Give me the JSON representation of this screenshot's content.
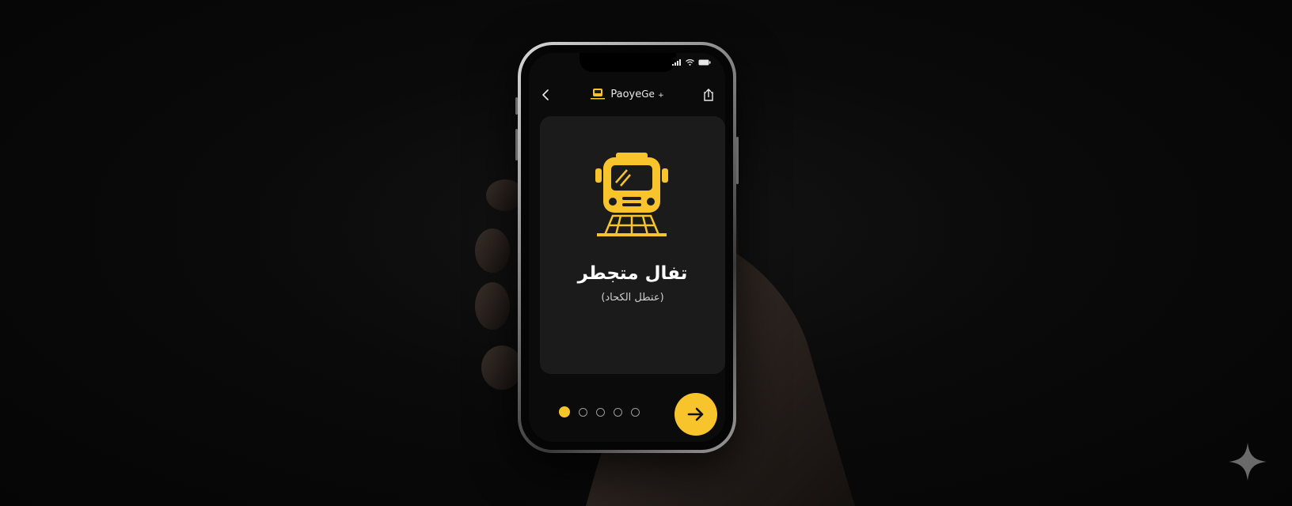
{
  "colors": {
    "accent": "#f7c42b",
    "screen_bg": "#0b0b0b",
    "card_bg": "#1b1b1b",
    "text_primary": "#ffffff",
    "text_secondary": "#cfcfcf"
  },
  "status_bar": {
    "icons": [
      "signal-icon",
      "wifi-icon",
      "battery-icon"
    ]
  },
  "header": {
    "back_icon": "chevron-left-icon",
    "logo_icon": "bus-logo-icon",
    "brand_name": "Paoye",
    "brand_name_2": "Ge",
    "brand_suffix": "+",
    "share_icon": "share-icon"
  },
  "card": {
    "illustration": "bus-icon",
    "title": "تفال متجطر",
    "subtitle": "(عتطل الكحاد)"
  },
  "pagination": {
    "total": 5,
    "active_index": 0
  },
  "next_button": {
    "icon": "arrow-right-icon"
  },
  "watermark_icon": "sparkle-icon"
}
